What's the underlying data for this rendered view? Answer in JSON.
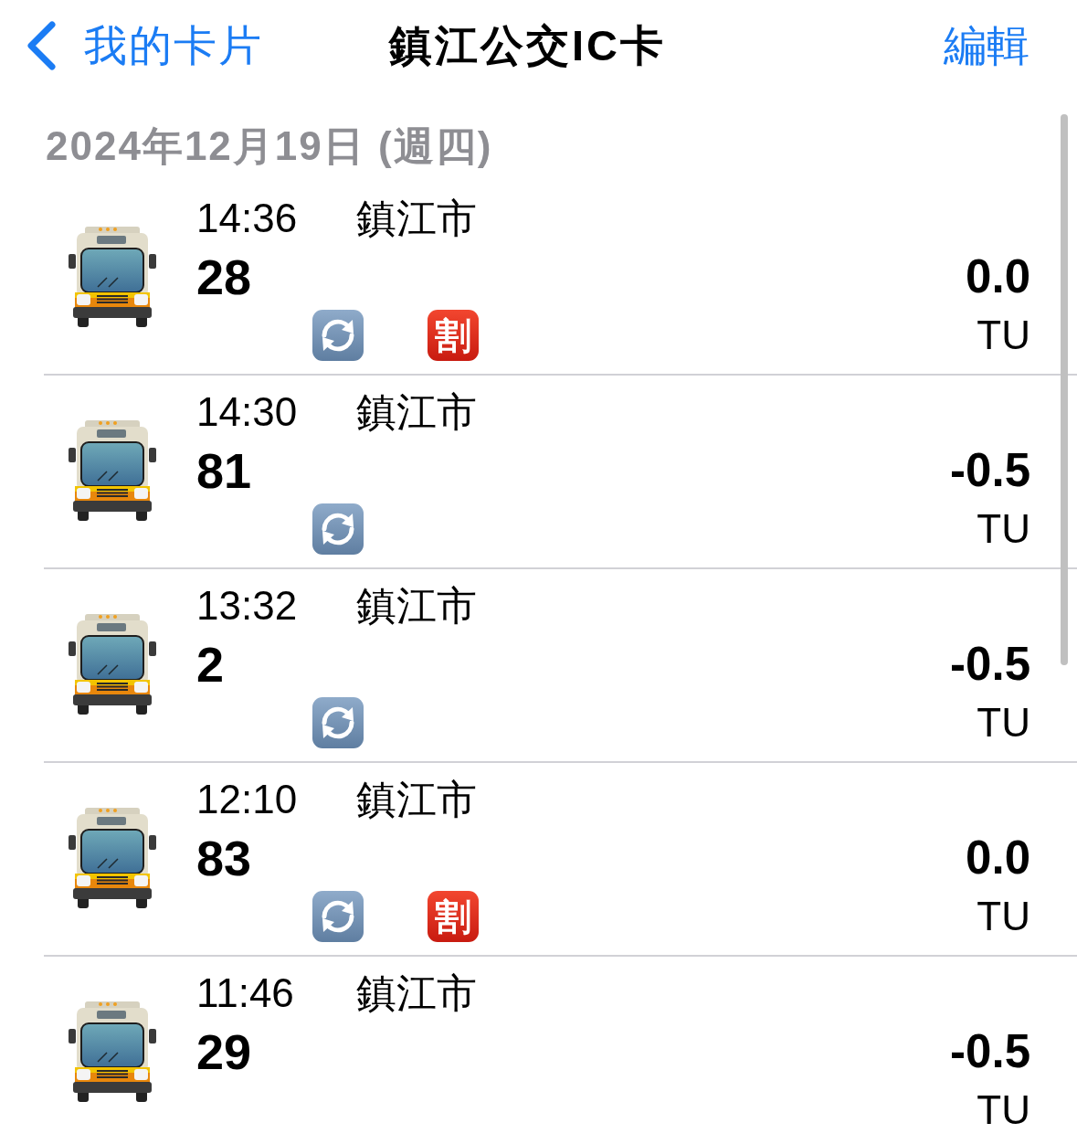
{
  "nav": {
    "back_label": "我的卡片",
    "title": "鎮江公交IC卡",
    "edit_label": "編輯"
  },
  "section": {
    "date": "2024年12月19日 (週四)"
  },
  "transactions": [
    {
      "time": "14:36",
      "city": "鎮江市",
      "route": "28",
      "amount": "0.0",
      "unit": "TU",
      "transfer": true,
      "discount_badge": "割"
    },
    {
      "time": "14:30",
      "city": "鎮江市",
      "route": "81",
      "amount": "-0.5",
      "unit": "TU",
      "transfer": true
    },
    {
      "time": "13:32",
      "city": "鎮江市",
      "route": "2",
      "amount": "-0.5",
      "unit": "TU",
      "transfer": true
    },
    {
      "time": "12:10",
      "city": "鎮江市",
      "route": "83",
      "amount": "0.0",
      "unit": "TU",
      "transfer": true,
      "discount_badge": "割"
    },
    {
      "time": "11:46",
      "city": "鎮江市",
      "route": "29",
      "amount": "-0.5",
      "unit": "TU",
      "transfer": false
    }
  ]
}
